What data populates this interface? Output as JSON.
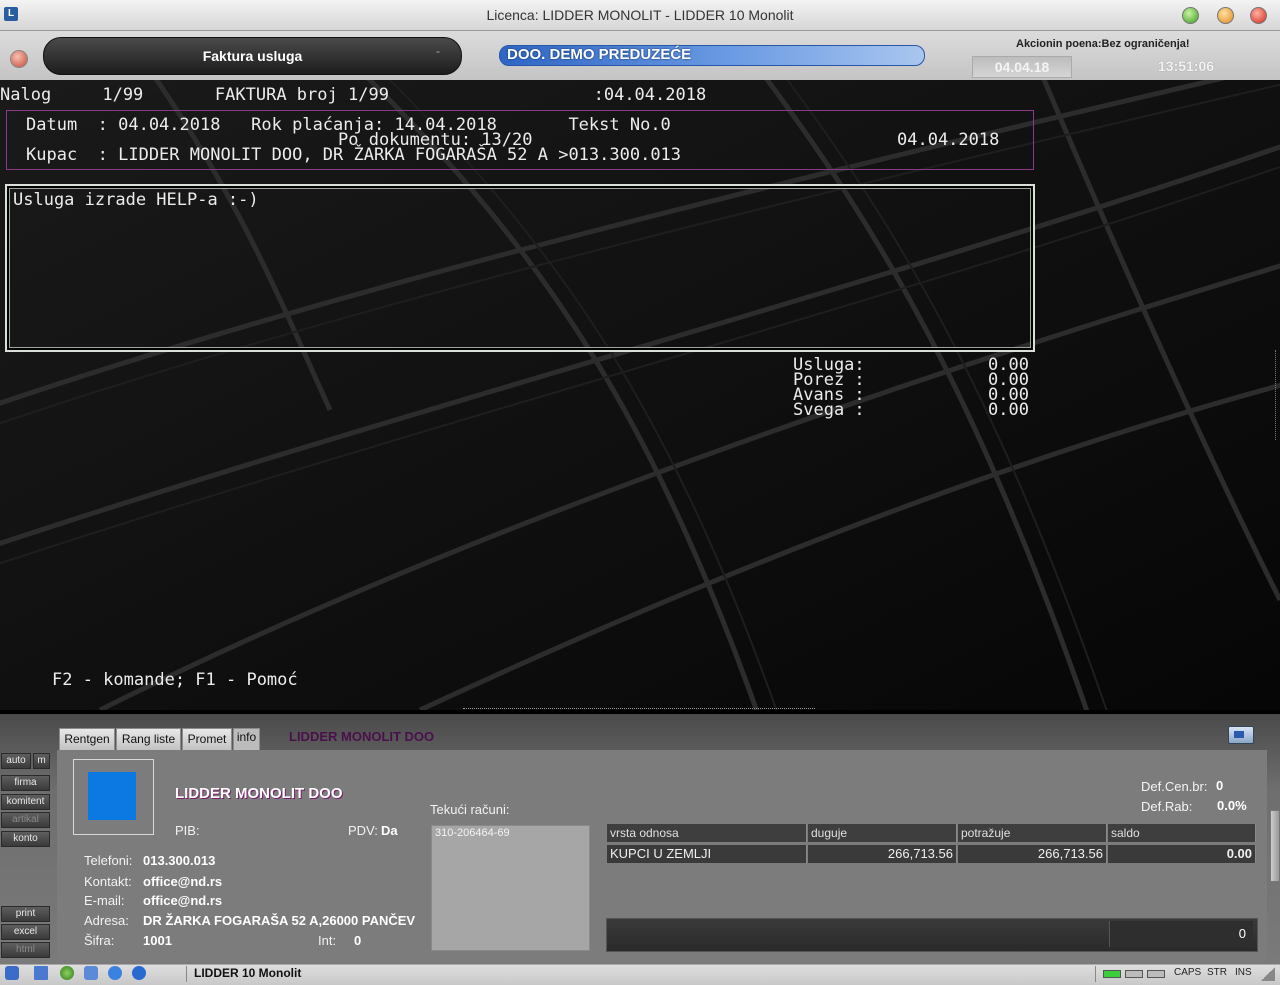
{
  "window": {
    "title": "Licenca: LIDDER MONOLIT - LIDDER 10 Monolit"
  },
  "header": {
    "module_label": "Faktura usluga",
    "module_dash": "-",
    "company": "DOO. DEMO PREDUZEĆE",
    "promo": "Akcionin poena:Bez ograničenja!",
    "date": "04.04.18",
    "time": "13:51:06"
  },
  "terminal": {
    "line_nalog": "Nalog     1/99       FAKTURA broj 1/99                    :04.04.2018",
    "line_datum": "Datum  : 04.04.2018   Rok plaćanja: 14.04.2018       Tekst No.0",
    "line_podok": "Po dokumentu: 13/20",
    "line_date_right": "04.04.2018",
    "line_kupac": "Kupac  : LIDDER MONOLIT DOO, DR ŽARKA FOGARAŠA 52 A >013.300.013",
    "text_body": "Usluga izrade HELP-a :-)",
    "totals": [
      {
        "label": "Usluga:",
        "value": "0.00"
      },
      {
        "label": "Porez :",
        "value": "0.00"
      },
      {
        "label": "Avans :",
        "value": "0.00"
      },
      {
        "label": "Svega :",
        "value": "0.00"
      }
    ],
    "hint": "F2 - komande; F1 - Pomoć"
  },
  "panel": {
    "tabs": [
      "Rentgen",
      "Rang liste",
      "Promet",
      "info"
    ],
    "title": "LIDDER MONOLIT DOO",
    "side_buttons": [
      "auto",
      "m",
      "firma",
      "komitent",
      "artikal",
      "konto",
      "print",
      "excel",
      "html"
    ],
    "company_name": "LIDDER MONOLIT DOO",
    "pib_label": "PIB:",
    "pdv_label": "PDV:",
    "pdv_value": "Da",
    "telefoni_label": "Telefoni:",
    "telefoni_value": "013.300.013",
    "kontakt_label": "Kontakt:",
    "kontakt_value": "office@nd.rs",
    "email_label": "E-mail:",
    "email_value": "office@nd.rs",
    "adresa_label": "Adresa:",
    "adresa_value": "DR ŽARKA FOGARAŠA 52 A,26000 PANČEV",
    "sifra_label": "Šifra:",
    "sifra_value": "1001",
    "int_label": "Int:",
    "int_value": "0",
    "tekuci_label": "Tekući računi:",
    "tekuci_value": "310-206464-69",
    "defcen_label": "Def.Cen.br:",
    "defcen_value": "0",
    "defrab_label": "Def.Rab:",
    "defrab_value": "0.0%",
    "grid": {
      "headers": [
        "vrsta odnosa",
        "duguje",
        "potražuje",
        "saldo"
      ],
      "row": [
        "KUPCI U ZEMLJI",
        "266,713.56",
        "266,713.56",
        "0.00"
      ]
    },
    "bottom_value": "0"
  },
  "statusbar": {
    "app": "LIDDER 10 Monolit",
    "caps": "CAPS",
    "str": "STR",
    "ins": "INS"
  }
}
